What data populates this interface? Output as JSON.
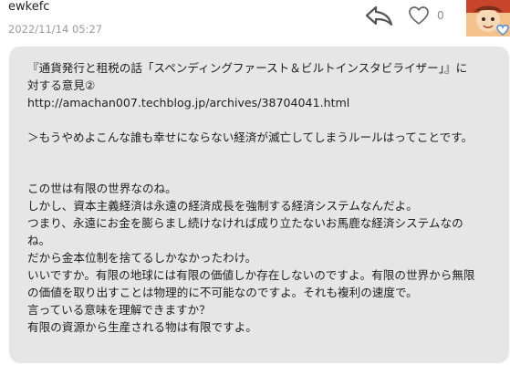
{
  "comment": {
    "username": "ewkefc",
    "timestamp": "2022/11/14 05:27",
    "like_count": "0",
    "reply_icon": "reply-arrow-icon",
    "like_icon": "heart-outline-icon",
    "body": "『通貨発行と租税の話「スペンディングファースト＆ビルトインスタビライザー」』に\n対する意見②\nhttp://amachan007.techblog.jp/archives/38704041.html\n\n＞もうやめよこんな誰も幸せにならない経済が滅亡してしまうルールはってことです。\n\n\nこの世は有限の世界なのね。\nしかし、資本主義経済は永遠の経済成長を強制する経済システムなんだよ。\nつまり、永遠にお金を膨らまし続けなければ成り立たないお馬鹿な経済システムなの\nね。\nだから金本位制を捨てるしかなかったわけ。\nいいですか。有限の地球には有限の価値しか存在しないのですよ。有限の世界から無限\nの価値を取り出すことは物理的に不可能なのですよ。それも複利の速度で。\n言っている意味を理解できますか？\n有限の資源から生産される物は有限ですよ。"
  },
  "colors": {
    "bubble_bg": "#e6e6e6",
    "timestamp": "#9a9a9a",
    "icon": "#555555"
  }
}
